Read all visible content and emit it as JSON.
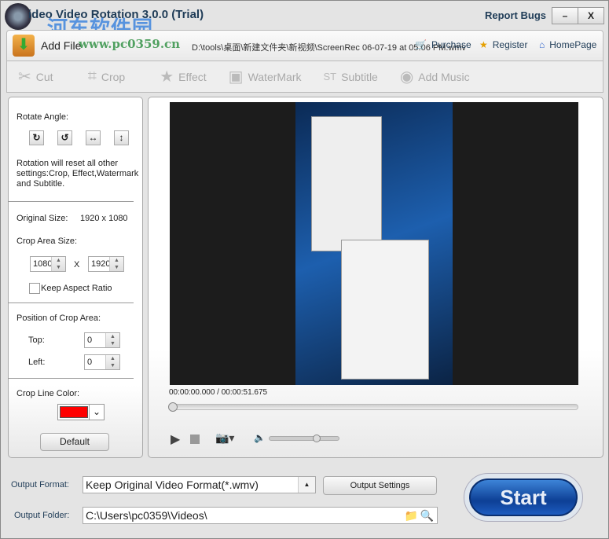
{
  "window": {
    "title": "ideo Video Rotation 3.0.0 (Trial)",
    "report_bugs": "Report Bugs",
    "minimize": "–",
    "close": "X"
  },
  "watermark": {
    "cn": "河东软件园",
    "url": "www.pc0359.cn"
  },
  "filebar": {
    "add_file": "Add File",
    "path": "D:\\tools\\桌面\\新建文件夹\\新视频\\ScreenRec 06-07-19 at 05.06 PM.wmv",
    "purchase": "Purchase",
    "register": "Register",
    "homepage": "HomePage"
  },
  "toolbar": [
    {
      "label": "Cut",
      "icon": "✂"
    },
    {
      "label": "Crop",
      "icon": "⌗"
    },
    {
      "label": "Effect",
      "icon": "★"
    },
    {
      "label": "WaterMark",
      "icon": "▣"
    },
    {
      "label": "Subtitle",
      "icon": "ST"
    },
    {
      "label": "Add Music",
      "icon": "◉"
    }
  ],
  "left": {
    "rotate_angle": "Rotate Angle:",
    "rotate_note": "Rotation will reset all other settings:Crop, Effect,Watermark and Subtitle.",
    "original_size_label": "Original Size:",
    "original_size": "1920 x 1080",
    "crop_area_size": "Crop Area Size:",
    "crop_w": "1080",
    "x": "X",
    "crop_h": "1920",
    "keep_aspect": "Keep Aspect Ratio",
    "keep_aspect_checked": false,
    "position": "Position of Crop Area:",
    "top_label": "Top:",
    "top": "0",
    "left_label": "Left:",
    "left": "0",
    "crop_color_label": "Crop Line Color:",
    "crop_color": "#ff0000",
    "default": "Default"
  },
  "player": {
    "time": "00:00:00.000 / 00:00:51.675",
    "progress": 0,
    "volume": 0.75
  },
  "output": {
    "format_label": "Output Format:",
    "format": "Keep Original Video Format(*.wmv)",
    "settings": "Output Settings",
    "folder_label": "Output Folder:",
    "folder": "C:\\Users\\pc0359\\Videos\\",
    "start": "Start"
  }
}
